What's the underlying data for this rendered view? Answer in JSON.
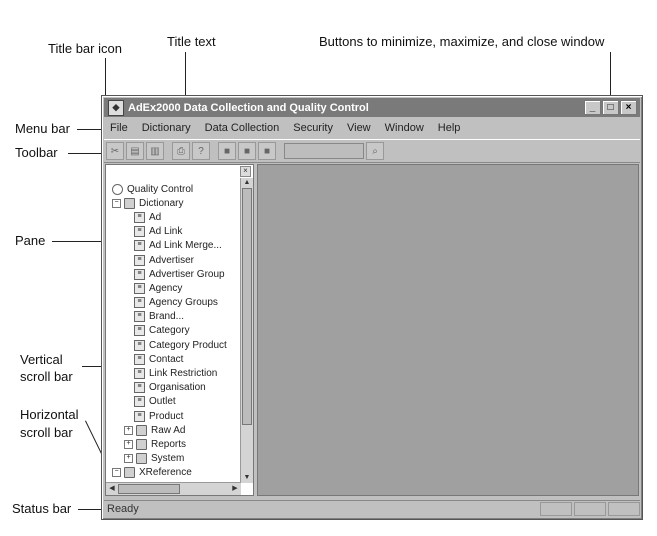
{
  "callouts": {
    "title_bar_icon": "Title bar icon",
    "title_text": "Title text",
    "window_buttons": "Buttons to minimize, maximize, and close window",
    "menu_bar": "Menu bar",
    "toolbar": "Toolbar",
    "pane": "Pane",
    "vertical_1": "Vertical",
    "vertical_2": "scroll bar",
    "horizontal_1": "Horizontal",
    "horizontal_2": "scroll bar",
    "status_bar": "Status bar"
  },
  "window": {
    "title": "AdEx2000 Data Collection and Quality Control",
    "minimize": "_",
    "maximize": "□",
    "close": "×"
  },
  "menu": [
    "File",
    "Dictionary",
    "Data Collection",
    "Security",
    "View",
    "Window",
    "Help"
  ],
  "toolbar_icons": [
    "cut-icon",
    "copy-icon",
    "paste-icon",
    "print-icon",
    "help-icon",
    "record-first-icon",
    "record-prev-icon",
    "record-next-icon",
    "search-icon"
  ],
  "tree": {
    "root": "Quality Control",
    "dictionary": "Dictionary",
    "dictionary_items": [
      "Ad",
      "Ad Link",
      "Ad Link Merge...",
      "Advertiser",
      "Advertiser Group",
      "Agency",
      "Agency Groups",
      "Brand...",
      "Category",
      "Category Product",
      "Contact",
      "Link Restriction",
      "Organisation",
      "Outlet",
      "Product"
    ],
    "folders": [
      "Raw Ad",
      "Reports",
      "System"
    ],
    "xref": "XReference"
  },
  "pane_close": "×",
  "status": {
    "text": "Ready"
  }
}
